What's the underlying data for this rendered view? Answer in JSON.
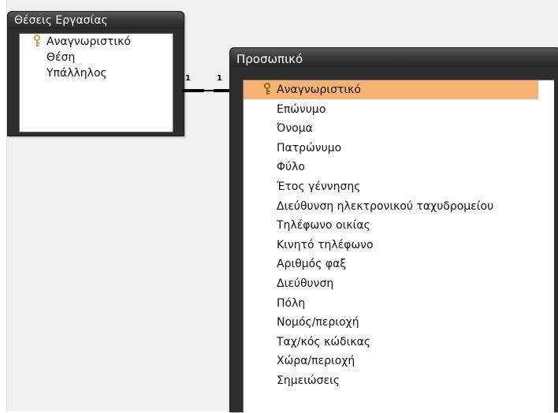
{
  "tables": {
    "left": {
      "title": "Θέσεις Εργασίας",
      "fields": [
        {
          "label": "Αναγνωριστικό",
          "primary_key": true
        },
        {
          "label": "Θέση",
          "primary_key": false
        },
        {
          "label": "Υπάλληλος",
          "primary_key": false
        }
      ]
    },
    "right": {
      "title": "Προσωπικό",
      "selected_index": 0,
      "fields": [
        {
          "label": "Αναγνωριστικό",
          "primary_key": true
        },
        {
          "label": "Επώνυμο",
          "primary_key": false
        },
        {
          "label": "Όνομα",
          "primary_key": false
        },
        {
          "label": "Πατρώνυμο",
          "primary_key": false
        },
        {
          "label": "Φύλο",
          "primary_key": false
        },
        {
          "label": "Έτος γέννησης",
          "primary_key": false
        },
        {
          "label": "Διεύθυνση ηλεκτρονικού ταχυδρομείου",
          "primary_key": false
        },
        {
          "label": "Τηλέφωνο οικίας",
          "primary_key": false
        },
        {
          "label": "Κινητό τηλέφωνο",
          "primary_key": false
        },
        {
          "label": "Αριθμός φαξ",
          "primary_key": false
        },
        {
          "label": "Διεύθυνση",
          "primary_key": false
        },
        {
          "label": "Πόλη",
          "primary_key": false
        },
        {
          "label": "Νομός/περιοχή",
          "primary_key": false
        },
        {
          "label": "Ταχ/κός κώδικας",
          "primary_key": false
        },
        {
          "label": "Χώρα/περιοχή",
          "primary_key": false
        },
        {
          "label": "Σημειώσεις",
          "primary_key": false
        }
      ]
    }
  },
  "relationship": {
    "left_cardinality": "1",
    "right_cardinality": "1"
  },
  "colors": {
    "selected_row": "#f9b274",
    "title_bar": "#2d2d2d",
    "key_icon": "#c8a24a"
  }
}
